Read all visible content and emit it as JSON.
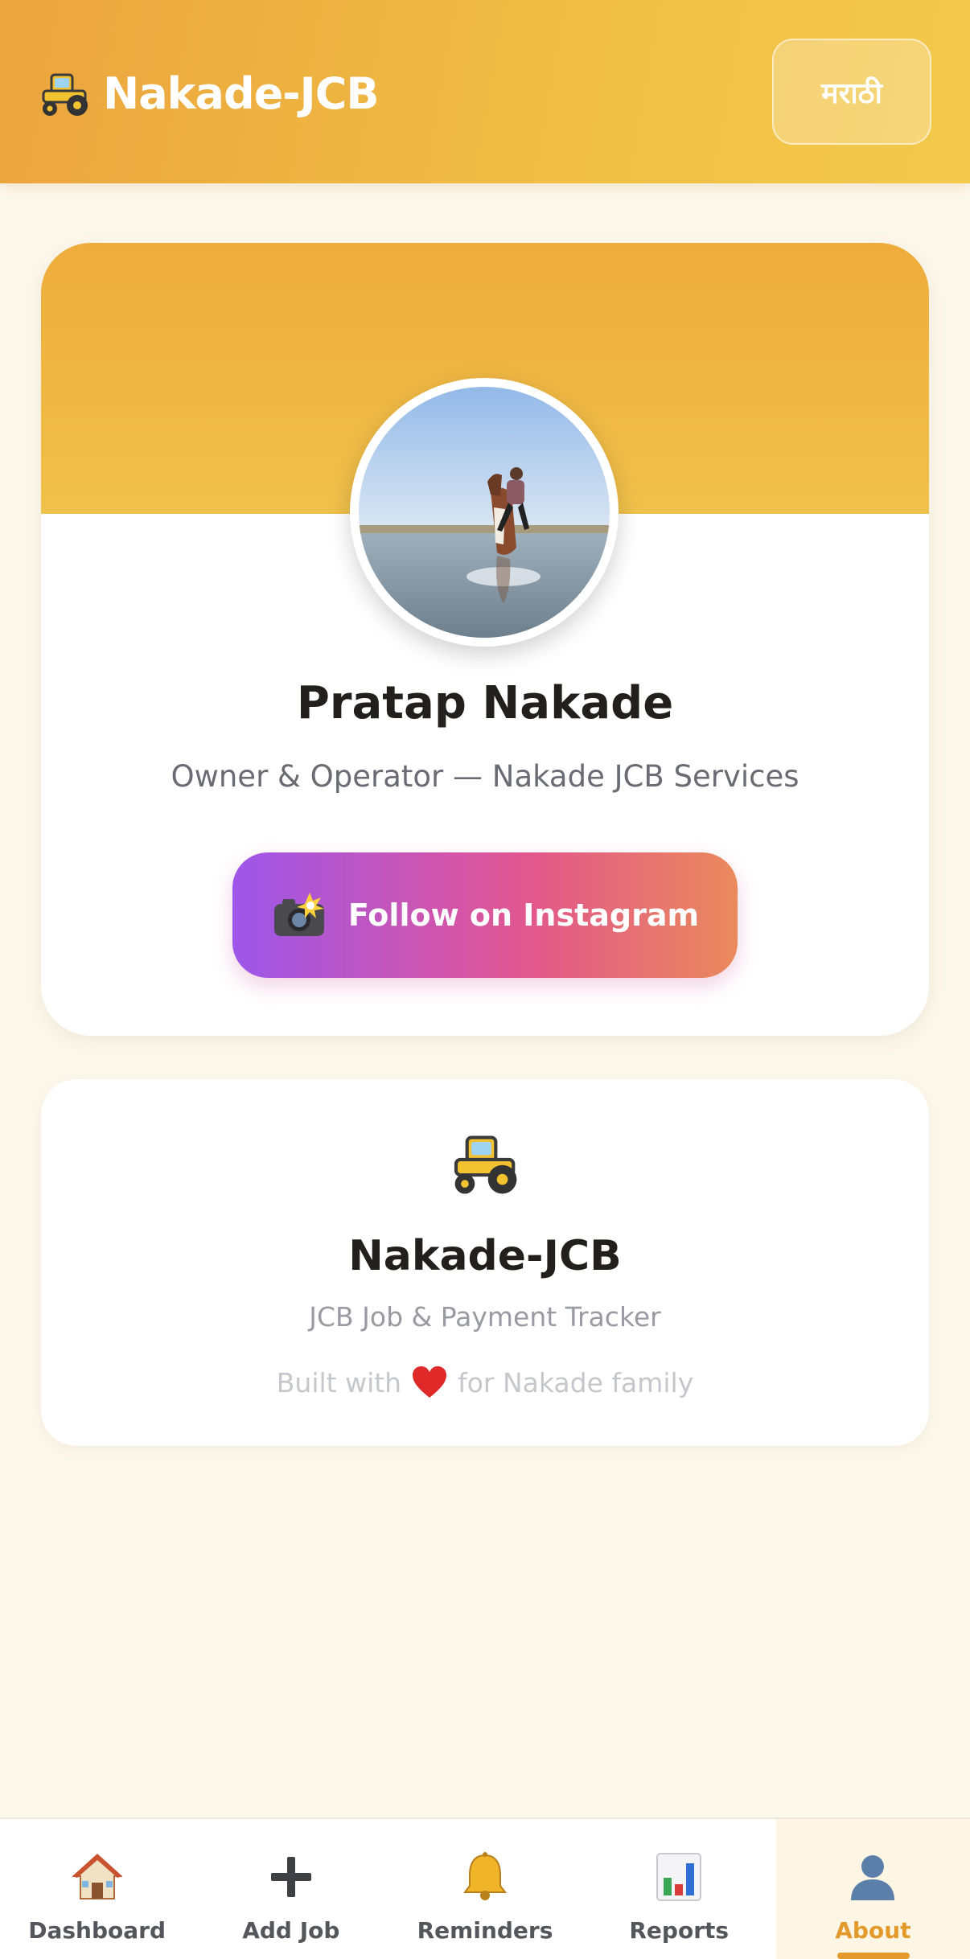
{
  "header": {
    "app_title": "Nakade-JCB",
    "brand_icon": "tractor-icon",
    "language_button": "मराठी"
  },
  "profile": {
    "name": "Pratap Nakade",
    "role": "Owner & Operator — Nakade JCB Services",
    "photo_icon": "profile-photo",
    "instagram_button": "Follow on Instagram",
    "instagram_icon": "camera-flash-icon"
  },
  "app_info": {
    "icon": "tractor-icon",
    "name": "Nakade-JCB",
    "description": "JCB Job & Payment Tracker",
    "credit_before": "Built with",
    "credit_icon": "heart-icon",
    "credit_after": "for Nakade family"
  },
  "bottom_nav": {
    "items": [
      {
        "label": "Dashboard",
        "icon": "house-icon"
      },
      {
        "label": "Add Job",
        "icon": "plus-icon"
      },
      {
        "label": "Reminders",
        "icon": "bell-icon"
      },
      {
        "label": "Reports",
        "icon": "bar-chart-icon"
      },
      {
        "label": "About",
        "icon": "person-icon"
      }
    ],
    "active": "About"
  },
  "colors": {
    "accent": "#e39a2b",
    "header_start": "#eba43e",
    "header_end": "#f3c94c",
    "background": "#fdf8ec",
    "instagram_start": "#9d57ea",
    "instagram_end": "#ea8a5c"
  }
}
